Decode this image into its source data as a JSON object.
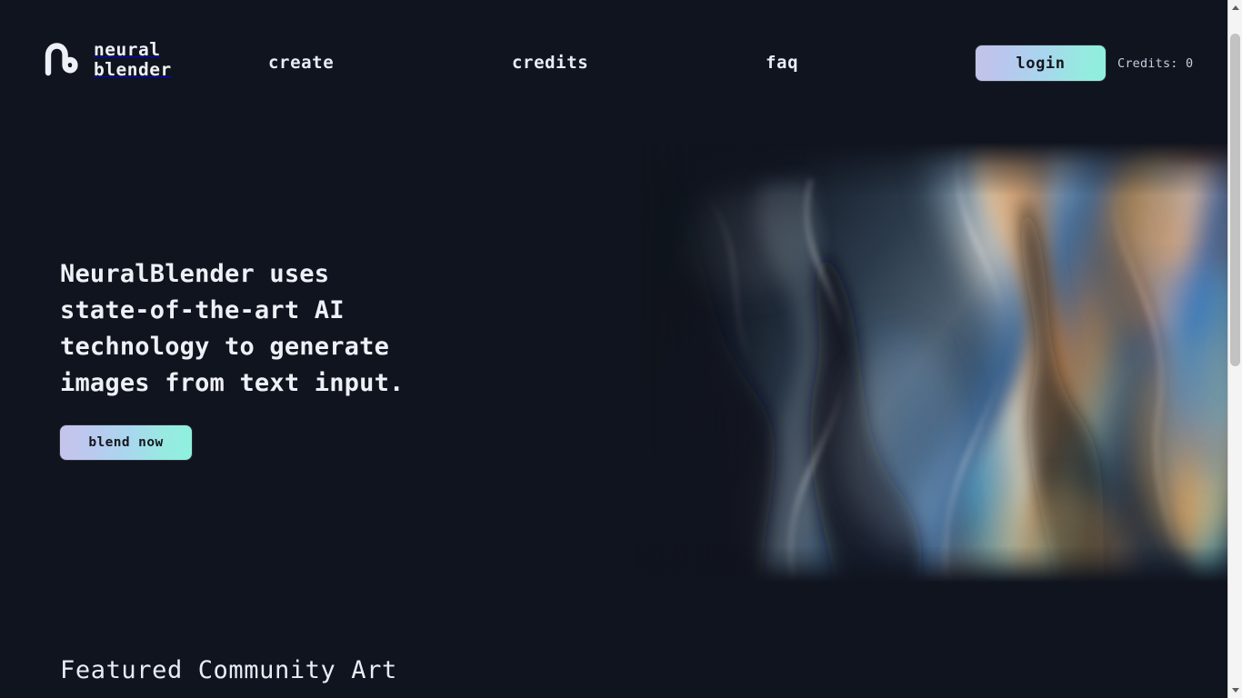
{
  "theme": {
    "background": "#10141e",
    "text": "#e9ecf5",
    "accent_gradient_start": "#c3c3e8",
    "accent_gradient_end": "#8ef0dd",
    "button_text": "#16161d",
    "scrollbar_track": "#f4f4f4",
    "scrollbar_thumb": "#c2c2c2"
  },
  "header": {
    "brand": {
      "icon": "neuralblender-logo-icon",
      "name": "neural\nblender"
    },
    "nav": [
      {
        "id": "create",
        "label": "create"
      },
      {
        "id": "credits",
        "label": "credits"
      },
      {
        "id": "faq",
        "label": "faq"
      }
    ],
    "login_label": "login",
    "credits_label": "Credits: 0"
  },
  "hero": {
    "heading": "NeuralBlender uses\nstate-of-the-art AI\ntechnology to generate\nimages from text input.",
    "cta_label": "blend now",
    "artwork_alt": "abstract iridescent fluid marbled artwork"
  },
  "featured": {
    "heading": "Featured Community Art"
  },
  "scrollbar": {
    "up_arrow": "scroll-up-arrow-icon",
    "down_arrow": "scroll-down-arrow-icon",
    "position_percent": 0
  }
}
